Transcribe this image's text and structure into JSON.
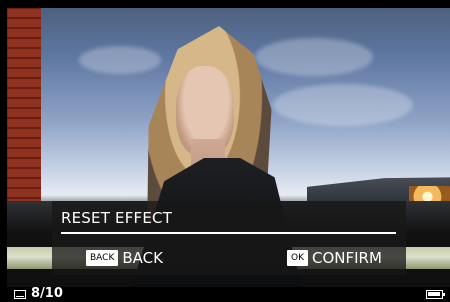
{
  "dialog": {
    "title": "RESET EFFECT",
    "back_key": "BACK",
    "back_label": "BACK",
    "confirm_key": "OK",
    "confirm_label": "CONFIRM"
  },
  "status": {
    "page": "8/10",
    "battery_icon": "battery-full-icon",
    "frame_icon": "display-frame-icon",
    "battery_level": 1
  },
  "photo": {
    "subject": "portrait"
  },
  "colors": {
    "overlay": "#181818",
    "text": "#FFFFFF",
    "key_background": "#FFFFFF",
    "divider": "#FFFFFF"
  }
}
